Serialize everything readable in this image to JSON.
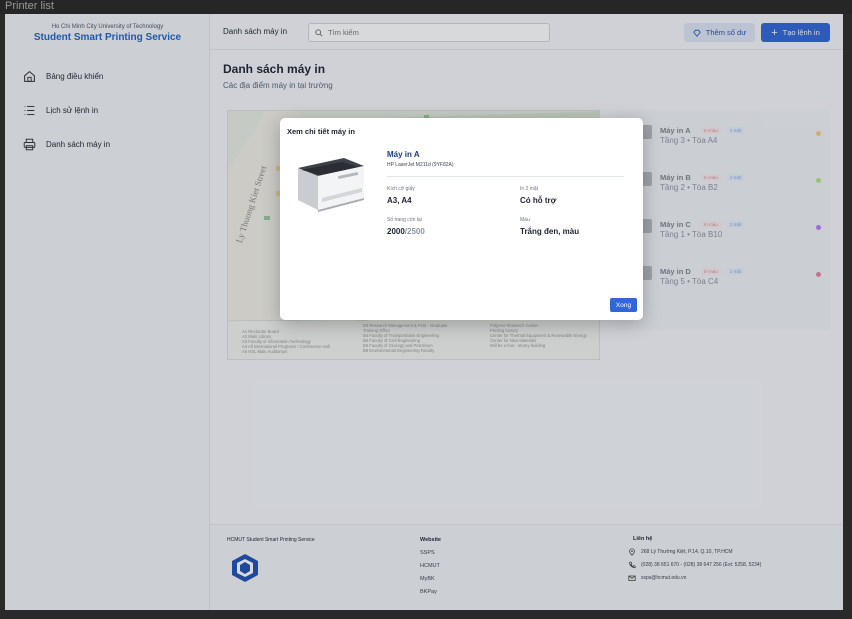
{
  "window": {
    "title": "Printer list"
  },
  "brand": {
    "university": "Ho Chi Minh City University of Technology",
    "service": "Student Smart Printing Service"
  },
  "sidebar": {
    "items": [
      {
        "label": "Bảng điều khiển",
        "icon": "home-icon"
      },
      {
        "label": "Lịch sử lệnh in",
        "icon": "list-icon"
      },
      {
        "label": "Danh sách máy in",
        "icon": "printer-icon"
      }
    ]
  },
  "topbar": {
    "title": "Danh sách máy in",
    "search_placeholder": "Tìm kiếm",
    "balance_button": "Thêm số dư",
    "create_button": "Tạo lệnh in"
  },
  "main": {
    "title": "Danh sách máy in",
    "subtitle": "Các địa điểm máy in tại trường"
  },
  "printers": [
    {
      "name": "Máy in A",
      "location": "Tầng 3 • Tòa A4",
      "tag_color": "In màu",
      "tag_duplex": "2 mặt",
      "status_color": "#f5a623"
    },
    {
      "name": "Máy in B",
      "location": "Tầng 2 • Tòa B2",
      "tag_color": "In màu",
      "tag_duplex": "2 mặt",
      "status_color": "#7ed321"
    },
    {
      "name": "Máy in C",
      "location": "Tầng 1 • Tòa B10",
      "tag_color": "In màu",
      "tag_duplex": "2 mặt",
      "status_color": "#9013fe"
    },
    {
      "name": "Máy in D",
      "location": "Tầng 5 • Tòa C4",
      "tag_color": "In màu",
      "tag_duplex": "2 mặt",
      "status_color": "#e0245e"
    }
  ],
  "modal": {
    "title": "Xem chi tiết máy in",
    "printer_name": "Máy in A",
    "model": "HP LaserJet M211d (9YF82A)",
    "paper_size_label": "Kích cỡ giấy",
    "paper_size_value": "A3, A4",
    "duplex_label": "In 2 mặt",
    "duplex_value": "Có hỗ trợ",
    "pages_label": "Số trang còn lại",
    "pages_remaining": "2000",
    "pages_total": "/2500",
    "color_label": "Màu",
    "color_value": "Trắng đen, màu",
    "done_button": "Xong"
  },
  "footer": {
    "brand": "HCMUT Student Smart Printing Service",
    "website_title": "Website",
    "websites": [
      "SSPS",
      "HCMUT",
      "MyBK",
      "BKPay"
    ],
    "contact_title": "Liên hệ",
    "address": "268 Lý Thường Kiệt, P.14, Q.10, TP.HCM",
    "phone": "(028) 38 651 670 - (028) 38 647 256 (Ext: 5258, 5234)",
    "email": "ssps@hcmut.edu.vn"
  },
  "map": {
    "street_label": "Ly Thuong Kiet Street",
    "legend": [
      "A1  Rectorate Board",
      "A2  Main Library",
      "A3  Faculty of Information Technology",
      "A4  All International Programs / Conference Hall",
      "A5  HSL Main Auditorium",
      "B3  Research Management & Post - Graduate",
      "Training Office",
      "B4  Faculty of Transportation Engineering",
      "B5  Faculty of Civil Engineering",
      "B6  Faculty of Geology and Petroleum",
      "B8  Environmental Engineering Faculty",
      "Polymer Research Center",
      "Printing factory",
      "Center for Thermal Equipment & Renewable Energy",
      "Center for New Materials",
      "Will be a four - storey building"
    ]
  },
  "colors": {
    "accent": "#2f66d8",
    "brand": "#1f63c7"
  }
}
